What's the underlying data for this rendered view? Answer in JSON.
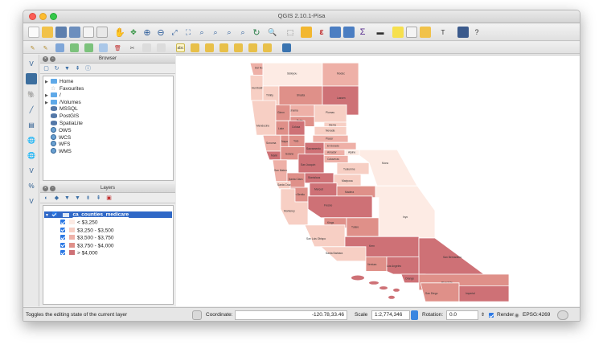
{
  "window": {
    "title": "QGIS 2.10.1-Pisa"
  },
  "browser_panel": {
    "title": "Browser",
    "items": [
      {
        "label": "Home",
        "icon": "folder-icon",
        "expandable": true
      },
      {
        "label": "Favourites",
        "icon": "star-icon",
        "expandable": false
      },
      {
        "label": "/",
        "icon": "folder-icon",
        "expandable": true
      },
      {
        "label": "/Volumes",
        "icon": "folder-icon",
        "expandable": true
      },
      {
        "label": "MSSQL",
        "icon": "mssql-icon",
        "expandable": false
      },
      {
        "label": "PostGIS",
        "icon": "postgis-icon",
        "expandable": false
      },
      {
        "label": "SpatiaLite",
        "icon": "spatialite-icon",
        "expandable": false
      },
      {
        "label": "OWS",
        "icon": "globe-icon",
        "expandable": false
      },
      {
        "label": "WCS",
        "icon": "globe-icon",
        "expandable": false
      },
      {
        "label": "WFS",
        "icon": "globe-icon",
        "expandable": false
      },
      {
        "label": "WMS",
        "icon": "globe-icon",
        "expandable": false
      }
    ]
  },
  "layers_panel": {
    "title": "Layers",
    "layer_name": "ca_counties_medicare",
    "classes": [
      {
        "label": "< $3,250",
        "color": "#fdebe4"
      },
      {
        "label": "$3,250 - $3,500",
        "color": "#f7cfc4"
      },
      {
        "label": "$3,500 - $3,750",
        "color": "#eeb0a7"
      },
      {
        "label": "$3,750 - $4,000",
        "color": "#df9089"
      },
      {
        "label": "> $4,000",
        "color": "#ce7176"
      }
    ]
  },
  "map": {
    "counties": [
      {
        "name": "Del Norte",
        "cls": 2
      },
      {
        "name": "Siskiyou",
        "cls": 0
      },
      {
        "name": "Modoc",
        "cls": 2
      },
      {
        "name": "Humboldt",
        "cls": 1
      },
      {
        "name": "Trinity",
        "cls": 1
      },
      {
        "name": "Shasta",
        "cls": 3
      },
      {
        "name": "Lassen",
        "cls": 4
      },
      {
        "name": "Tehama",
        "cls": 2
      },
      {
        "name": "Plumas",
        "cls": 1
      },
      {
        "name": "Mendocino",
        "cls": 1
      },
      {
        "name": "Glenn",
        "cls": 3
      },
      {
        "name": "Butte",
        "cls": 3
      },
      {
        "name": "Sierra",
        "cls": 1
      },
      {
        "name": "Lake",
        "cls": 3
      },
      {
        "name": "Colusa",
        "cls": 4
      },
      {
        "name": "Nevada",
        "cls": 1
      },
      {
        "name": "Placer",
        "cls": 2
      },
      {
        "name": "Yolo",
        "cls": 3
      },
      {
        "name": "El Dorado",
        "cls": 2
      },
      {
        "name": "Sonoma",
        "cls": 2
      },
      {
        "name": "Napa",
        "cls": 3
      },
      {
        "name": "Sacramento",
        "cls": 4
      },
      {
        "name": "Amador",
        "cls": 2
      },
      {
        "name": "Alpine",
        "cls": 0
      },
      {
        "name": "Marin",
        "cls": 4
      },
      {
        "name": "Solano",
        "cls": 3
      },
      {
        "name": "Calaveras",
        "cls": 2
      },
      {
        "name": "Tuolumne",
        "cls": 1
      },
      {
        "name": "Mono",
        "cls": 0
      },
      {
        "name": "San Joaquin",
        "cls": 4
      },
      {
        "name": "Stanislaus",
        "cls": 4
      },
      {
        "name": "Mariposa",
        "cls": 1
      },
      {
        "name": "San Mateo",
        "cls": 2
      },
      {
        "name": "Santa Clara",
        "cls": 3
      },
      {
        "name": "Merced",
        "cls": 4
      },
      {
        "name": "Madera",
        "cls": 3
      },
      {
        "name": "Santa Cruz",
        "cls": 1
      },
      {
        "name": "San Benito",
        "cls": 3
      },
      {
        "name": "Fresno",
        "cls": 4
      },
      {
        "name": "Inyo",
        "cls": 0
      },
      {
        "name": "Monterey",
        "cls": 1
      },
      {
        "name": "Kings",
        "cls": 3
      },
      {
        "name": "Tulare",
        "cls": 3
      },
      {
        "name": "San Luis Obispo",
        "cls": 1
      },
      {
        "name": "Kern",
        "cls": 4
      },
      {
        "name": "San Bernardino",
        "cls": 4
      },
      {
        "name": "Santa Barbara",
        "cls": 1
      },
      {
        "name": "Ventura",
        "cls": 3
      },
      {
        "name": "Los Angeles",
        "cls": 4
      },
      {
        "name": "Orange",
        "cls": 4
      },
      {
        "name": "Riverside",
        "cls": 3
      },
      {
        "name": "San Diego",
        "cls": 3
      },
      {
        "name": "Imperial",
        "cls": 4
      }
    ]
  },
  "statusbar": {
    "message": "Toggles the editing state of the current layer",
    "coordinate_label": "Coordinate:",
    "coordinate_value": "-120.78,33.46",
    "scale_label": "Scale",
    "scale_value": "1:2,774,346",
    "rotation_label": "Rotation:",
    "rotation_value": "0.0",
    "render_label": "Render",
    "crs_label": "EPSG:4269"
  }
}
